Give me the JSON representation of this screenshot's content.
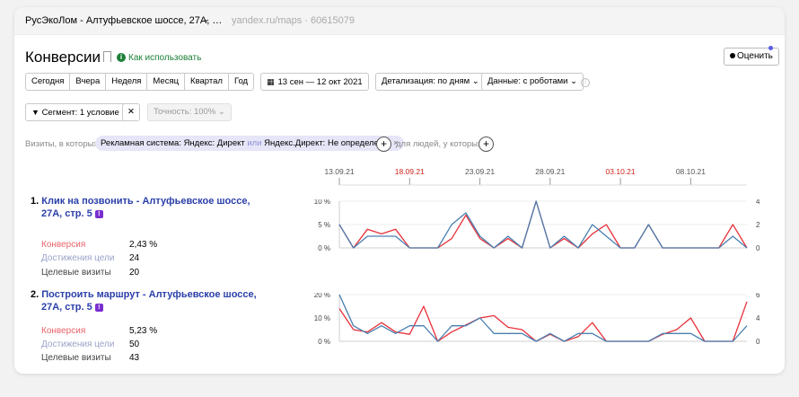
{
  "topbar": {
    "counter_name": "РусЭкоЛом - Алтуфьевское шоссе, 27А, …",
    "site": "yandex.ru/maps",
    "site_sep": " · ",
    "counter_id": "60615079"
  },
  "header": {
    "title": "Конверсии",
    "howto": "Как использовать",
    "rate_button": "Оценить"
  },
  "period": {
    "options": [
      "Сегодня",
      "Вчера",
      "Неделя",
      "Месяц",
      "Квартал",
      "Год"
    ],
    "date_range": "13 сен — 12 окт 2021",
    "detail": "Детализация: по дням",
    "data": "Данные: с роботами"
  },
  "segment": {
    "label": "Сегмент: 1 условие",
    "accuracy": "Точность: 100%"
  },
  "filter": {
    "visits_label": "Визиты, в которых",
    "chip_part1": "Рекламная система: Яндекс: Директ",
    "chip_or": "или",
    "chip_part2": "Яндекс.Директ: Не определено",
    "for_people": "для людей, у которых"
  },
  "timeline": {
    "labels": [
      "13.09.21",
      "18.09.21",
      "23.09.21",
      "28.09.21",
      "03.10.21",
      "08.10.21"
    ],
    "weekend_labels": [
      "18.09.21",
      "03.10.21"
    ]
  },
  "goals": [
    {
      "index": "1.",
      "title_line1": "Клик на позвонить - Алтуфьевское шоссе,",
      "title_line2": "27А, стр. 5",
      "conversion_label": "Конверсия",
      "conversion": "2,43 %",
      "achievements_label": "Достижения цели",
      "achievements": "24",
      "visits_label": "Целевые визиты",
      "visits": "20"
    },
    {
      "index": "2.",
      "title_line1": "Построить маршрут - Алтуфьевское шоссе,",
      "title_line2": "27А, стр. 5",
      "conversion_label": "Конверсия",
      "conversion": "5,23 %",
      "achievements_label": "Достижения цели",
      "achievements": "50",
      "visits_label": "Целевые визиты",
      "visits": "43"
    }
  ],
  "colors": {
    "red_series": "#e8313a",
    "blue_series": "#4a7fb0",
    "link": "#2a3fa8",
    "weekend": "#d0241a",
    "green": "#1a7f37"
  },
  "chart_data": [
    {
      "type": "line",
      "x_start": "13.09.21",
      "x": [
        "13.09.21",
        "14.09.21",
        "15.09.21",
        "16.09.21",
        "17.09.21",
        "18.09.21",
        "19.09.21",
        "20.09.21",
        "21.09.21",
        "22.09.21",
        "23.09.21",
        "24.09.21",
        "25.09.21",
        "26.09.21",
        "27.09.21",
        "28.09.21",
        "29.09.21",
        "30.09.21",
        "01.10.21",
        "02.10.21",
        "03.10.21",
        "04.10.21",
        "05.10.21",
        "06.10.21",
        "07.10.21",
        "08.10.21",
        "09.10.21",
        "10.10.21",
        "11.10.21",
        "12.10.21"
      ],
      "left_axis_ticks": [
        "10 %",
        "5 %",
        "0 %"
      ],
      "right_axis_ticks": [
        "4",
        "2",
        "0"
      ],
      "ylim_left": [
        0,
        10
      ],
      "ylim_right": [
        0,
        4
      ],
      "series": [
        {
          "axis": "left",
          "color": "red",
          "values": [
            5,
            0,
            4,
            3,
            4,
            0,
            0,
            0,
            2,
            7,
            2,
            0,
            2,
            0,
            10,
            0,
            2,
            0,
            3,
            5,
            0,
            0,
            5,
            0,
            0,
            0,
            0,
            0,
            5,
            0
          ]
        },
        {
          "axis": "right",
          "color": "blue",
          "values": [
            2,
            0,
            1,
            1,
            1,
            0,
            0,
            0,
            2,
            3,
            1,
            0,
            1,
            0,
            4,
            0,
            1,
            0,
            2,
            1,
            0,
            0,
            2,
            0,
            0,
            0,
            0,
            0,
            1,
            0
          ]
        }
      ]
    },
    {
      "type": "line",
      "x_start": "13.09.21",
      "x": [
        "13.09.21",
        "14.09.21",
        "15.09.21",
        "16.09.21",
        "17.09.21",
        "18.09.21",
        "19.09.21",
        "20.09.21",
        "21.09.21",
        "22.09.21",
        "23.09.21",
        "24.09.21",
        "25.09.21",
        "26.09.21",
        "27.09.21",
        "28.09.21",
        "29.09.21",
        "30.09.21",
        "01.10.21",
        "02.10.21",
        "03.10.21",
        "04.10.21",
        "05.10.21",
        "06.10.21",
        "07.10.21",
        "08.10.21",
        "09.10.21",
        "10.10.21",
        "11.10.21",
        "12.10.21"
      ],
      "left_axis_ticks": [
        "20 %",
        "10 %",
        "0 %"
      ],
      "right_axis_ticks": [
        "6",
        "4",
        "0"
      ],
      "ylim_left": [
        0,
        20
      ],
      "ylim_right": [
        0,
        6
      ],
      "series": [
        {
          "axis": "left",
          "color": "red",
          "values": [
            14,
            5,
            4,
            8,
            4,
            3,
            15,
            0,
            4,
            7,
            10,
            11,
            6,
            5,
            0,
            3,
            0,
            2,
            8,
            0,
            0,
            0,
            0,
            3,
            5,
            10,
            0,
            0,
            0,
            17
          ]
        },
        {
          "axis": "right",
          "color": "blue",
          "values": [
            6,
            2,
            1,
            2,
            1,
            2,
            2,
            0,
            2,
            2,
            3,
            1,
            1,
            1,
            0,
            1,
            0,
            1,
            1,
            0,
            0,
            0,
            0,
            1,
            1,
            1,
            0,
            0,
            0,
            2
          ]
        }
      ]
    }
  ]
}
